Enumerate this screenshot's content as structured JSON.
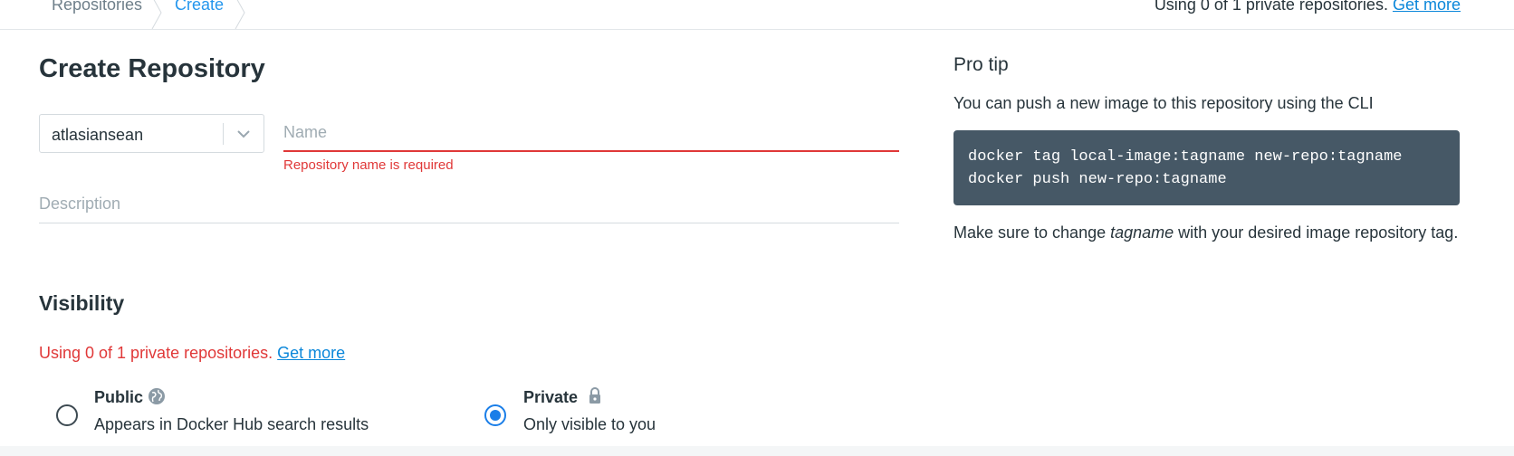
{
  "breadcrumb": {
    "items": [
      "Repositories",
      "Create"
    ]
  },
  "header": {
    "usage_text": "Using 0 of 1 private repositories.",
    "get_more_link": "Get more"
  },
  "page": {
    "title": "Create Repository"
  },
  "form": {
    "namespace": {
      "selected": "atlasiansean"
    },
    "name": {
      "value": "",
      "placeholder": "Name",
      "error": "Repository name is required"
    },
    "description": {
      "value": "",
      "placeholder": "Description"
    }
  },
  "visibility": {
    "title": "Visibility",
    "usage_text": "Using 0 of 1 private repositories.",
    "get_more_link": "Get more",
    "options": [
      {
        "label": "Public",
        "description": "Appears in Docker Hub search results",
        "selected": false,
        "icon": "globe-icon"
      },
      {
        "label": "Private",
        "description": "Only visible to you",
        "selected": true,
        "icon": "lock-icon"
      }
    ]
  },
  "pro_tip": {
    "title": "Pro tip",
    "intro": "You can push a new image to this repository using the CLI",
    "code_lines": [
      "docker tag local-image:tagname new-repo:tagname",
      "docker push new-repo:tagname"
    ],
    "note_before": "Make sure to change ",
    "note_emphasis": "tagname",
    "note_after": " with your desired image repository tag."
  },
  "colors": {
    "accent": "#2496ed",
    "link": "#0b87da",
    "error": "#e03838",
    "code_background": "#465866",
    "radio_selected": "#1a7ee8"
  }
}
